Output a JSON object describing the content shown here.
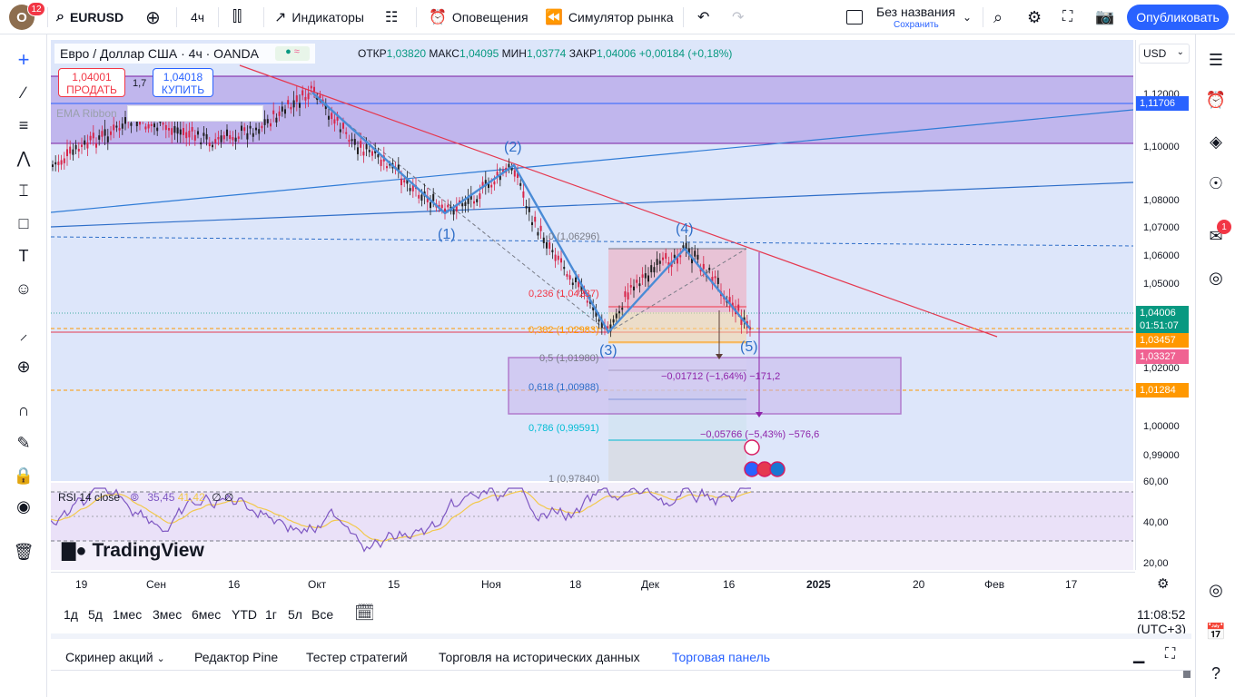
{
  "topbar": {
    "avatar_letter": "O",
    "avatar_badge": "12",
    "symbol": "EURUSD",
    "interval": "4ч",
    "indicators": "Индикаторы",
    "alerts": "Оповещения",
    "replay": "Симулятор рынка",
    "layout_name": "Без названия",
    "layout_save": "Сохранить",
    "publish": "Опубликовать"
  },
  "legend": {
    "symbol_title": "Евро / Доллар США · 4ч · OANDA",
    "open_label": "ОТКР",
    "open": "1,03820",
    "high_label": "МАКС",
    "high": "1,04095",
    "low_label": "МИН",
    "low": "1,03774",
    "close_label": "ЗАКР",
    "close": "1,04006",
    "change": "+0,00184 (+0,18%)"
  },
  "trade": {
    "sell_price": "1,04001",
    "sell_label": "ПРОДАТЬ",
    "spread": "1,7",
    "buy_price": "1,04018",
    "buy_label": "КУПИТЬ"
  },
  "indicator": {
    "ema_label": "EMA Ribbon"
  },
  "waves": [
    "(1)",
    "(2)",
    "(3)",
    "(4)",
    "(5)"
  ],
  "fib_levels": [
    {
      "label": "0 (1,06296)",
      "color": "#787b86"
    },
    {
      "label": "0,236 (1,04237)",
      "color": "#f23645"
    },
    {
      "label": "0,382 (1,02983)",
      "color": "#ff9800"
    },
    {
      "label": "0,5 (1,01980)",
      "color": "#787b86"
    },
    {
      "label": "0,618 (1,00988)",
      "color": "#2e6ec8"
    },
    {
      "label": "0,786 (0,99591)",
      "color": "#00bcd4"
    },
    {
      "label": "1 (0,97840)",
      "color": "#787b86"
    }
  ],
  "measures": {
    "m1": "−0,01712 (−1,64%) −171,2",
    "m2": "−0,05766 (−5,43%) −576,6"
  },
  "price_axis": {
    "currency": "USD",
    "ticks": [
      "1,12000",
      "1,10000",
      "1,08000",
      "1,07000",
      "1,06000",
      "1,05000",
      "1,02000",
      "1,00000",
      "0,99000"
    ],
    "labels": [
      {
        "text": "1,11706",
        "color": "#2962ff"
      },
      {
        "text": "1,04006",
        "color": "#089981"
      },
      {
        "text": "01:51:07",
        "color": "#089981"
      },
      {
        "text": "1,03457",
        "color": "#ff9800"
      },
      {
        "text": "1,03327",
        "color": "#f06292"
      },
      {
        "text": "1,01284",
        "color": "#ff9800"
      }
    ],
    "rsi_ticks": [
      "60,00",
      "40,00",
      "20,00"
    ]
  },
  "rsi": {
    "title": "RSI 14 close",
    "value": "35,45",
    "ma_value": "41,42"
  },
  "time_axis": [
    "19",
    "Сен",
    "16",
    "Окт",
    "15",
    "Ноя",
    "18",
    "Дек",
    "16",
    "2025",
    "20",
    "Фев",
    "17"
  ],
  "ranges": [
    "1д",
    "5д",
    "1мес",
    "3мес",
    "6мес",
    "YTD",
    "1г",
    "5л",
    "Все"
  ],
  "clock": "11:08:52 (UTC+3)",
  "bottom_tabs": [
    "Скринер акций",
    "Редактор Pine",
    "Тестер стратегий",
    "Торговля на исторических данных",
    "Торговая панель"
  ],
  "logo": "TradingView",
  "right_badge": "1"
}
